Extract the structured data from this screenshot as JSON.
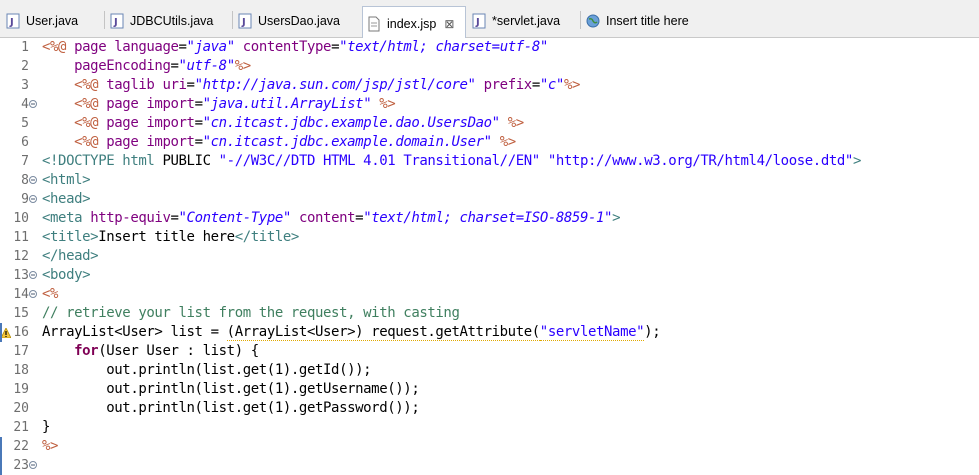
{
  "tabs": [
    {
      "label": "User.java",
      "icon": "java-file-icon",
      "active": false
    },
    {
      "label": "JDBCUtils.java",
      "icon": "java-file-icon",
      "active": false
    },
    {
      "label": "UsersDao.java",
      "icon": "java-file-icon",
      "active": false
    },
    {
      "label": "index.jsp",
      "icon": "jsp-file-icon",
      "active": true,
      "close": "⊠"
    },
    {
      "label": "*servlet.java",
      "icon": "java-file-icon",
      "active": false
    },
    {
      "label": "Insert title here",
      "icon": "globe-icon",
      "active": false
    }
  ],
  "lines": [
    {
      "n": "1",
      "fold": false,
      "warn": false,
      "segs": [
        [
          "jsp",
          "<%@ "
        ],
        [
          "attr",
          "page "
        ],
        [
          "attr",
          "language"
        ],
        [
          "plain",
          "="
        ],
        [
          "str",
          "\"java\""
        ],
        [
          "plain",
          " "
        ],
        [
          "attr",
          "contentType"
        ],
        [
          "plain",
          "="
        ],
        [
          "str",
          "\"text/html; charset=utf-8\""
        ]
      ]
    },
    {
      "n": "2",
      "fold": false,
      "warn": false,
      "segs": [
        [
          "plain",
          "    "
        ],
        [
          "attr",
          "pageEncoding"
        ],
        [
          "plain",
          "="
        ],
        [
          "str",
          "\"utf-8\""
        ],
        [
          "jsp",
          "%>"
        ]
      ]
    },
    {
      "n": "3",
      "fold": false,
      "warn": false,
      "segs": [
        [
          "plain",
          "    "
        ],
        [
          "jsp",
          "<%@ "
        ],
        [
          "attr",
          "taglib "
        ],
        [
          "attr",
          "uri"
        ],
        [
          "plain",
          "="
        ],
        [
          "str",
          "\"http://java.sun.com/jsp/jstl/core\""
        ],
        [
          "plain",
          " "
        ],
        [
          "attr",
          "prefix"
        ],
        [
          "plain",
          "="
        ],
        [
          "str",
          "\"c\""
        ],
        [
          "jsp",
          "%>"
        ]
      ]
    },
    {
      "n": "4",
      "fold": true,
      "warn": false,
      "segs": [
        [
          "plain",
          "    "
        ],
        [
          "jsp",
          "<%@ "
        ],
        [
          "attr",
          "page "
        ],
        [
          "attr",
          "import"
        ],
        [
          "plain",
          "="
        ],
        [
          "str",
          "\"java.util.ArrayList\""
        ],
        [
          "plain",
          " "
        ],
        [
          "jsp",
          "%>"
        ]
      ]
    },
    {
      "n": "5",
      "fold": false,
      "warn": false,
      "segs": [
        [
          "plain",
          "    "
        ],
        [
          "jsp",
          "<%@ "
        ],
        [
          "attr",
          "page "
        ],
        [
          "attr",
          "import"
        ],
        [
          "plain",
          "="
        ],
        [
          "str",
          "\"cn.itcast.jdbc.example.dao.UsersDao\""
        ],
        [
          "plain",
          " "
        ],
        [
          "jsp",
          "%>"
        ]
      ]
    },
    {
      "n": "6",
      "fold": false,
      "warn": false,
      "segs": [
        [
          "plain",
          "    "
        ],
        [
          "jsp",
          "<%@ "
        ],
        [
          "attr",
          "page "
        ],
        [
          "attr",
          "import"
        ],
        [
          "plain",
          "="
        ],
        [
          "str",
          "\"cn.itcast.jdbc.example.domain.User\""
        ],
        [
          "plain",
          " "
        ],
        [
          "jsp",
          "%>"
        ]
      ]
    },
    {
      "n": "7",
      "fold": false,
      "warn": false,
      "segs": [
        [
          "tag",
          "<!DOCTYPE "
        ],
        [
          "tag",
          "html "
        ],
        [
          "plain",
          "PUBLIC "
        ],
        [
          "javastr",
          "\"-//W3C//DTD HTML 4.01 Transitional//EN\""
        ],
        [
          "plain",
          " "
        ],
        [
          "javastr",
          "\"http://www.w3.org/TR/html4/loose.dtd\""
        ],
        [
          "tag",
          ">"
        ]
      ]
    },
    {
      "n": "8",
      "fold": true,
      "warn": false,
      "segs": [
        [
          "tag",
          "<html>"
        ]
      ]
    },
    {
      "n": "9",
      "fold": true,
      "warn": false,
      "segs": [
        [
          "tag",
          "<head>"
        ]
      ]
    },
    {
      "n": "10",
      "fold": false,
      "warn": false,
      "segs": [
        [
          "tag",
          "<meta "
        ],
        [
          "attr",
          "http-equiv"
        ],
        [
          "plain",
          "="
        ],
        [
          "str",
          "\"Content-Type\""
        ],
        [
          "plain",
          " "
        ],
        [
          "attr",
          "content"
        ],
        [
          "plain",
          "="
        ],
        [
          "str",
          "\"text/html; charset=ISO-8859-1\""
        ],
        [
          "tag",
          ">"
        ]
      ]
    },
    {
      "n": "11",
      "fold": false,
      "warn": false,
      "segs": [
        [
          "tag",
          "<title>"
        ],
        [
          "plain",
          "Insert title here"
        ],
        [
          "tag",
          "</title>"
        ]
      ]
    },
    {
      "n": "12",
      "fold": false,
      "warn": false,
      "segs": [
        [
          "tag",
          "</head>"
        ]
      ]
    },
    {
      "n": "13",
      "fold": true,
      "warn": false,
      "segs": [
        [
          "tag",
          "<body>"
        ]
      ]
    },
    {
      "n": "14",
      "fold": true,
      "warn": false,
      "segs": [
        [
          "jsp",
          "<%"
        ]
      ]
    },
    {
      "n": "15",
      "fold": false,
      "warn": false,
      "segs": [
        [
          "comment",
          "// retrieve your list from the request, with casting"
        ]
      ]
    },
    {
      "n": "16",
      "fold": false,
      "warn": true,
      "segs": [
        [
          "plain",
          "ArrayList<User> list = "
        ],
        [
          "warnplain",
          "(ArrayList<User>) request.getAttribute("
        ],
        [
          "warnstr",
          "\"servletName\""
        ],
        [
          "plain",
          ");"
        ]
      ]
    },
    {
      "n": "17",
      "fold": false,
      "warn": false,
      "segs": [
        [
          "plain",
          "    "
        ],
        [
          "kw",
          "for"
        ],
        [
          "plain",
          "(User User : list) {"
        ]
      ]
    },
    {
      "n": "18",
      "fold": false,
      "warn": false,
      "segs": [
        [
          "plain",
          "        out.println(list.get(1).getId());"
        ]
      ]
    },
    {
      "n": "19",
      "fold": false,
      "warn": false,
      "segs": [
        [
          "plain",
          "        out.println(list.get(1).getUsername());"
        ]
      ]
    },
    {
      "n": "20",
      "fold": false,
      "warn": false,
      "segs": [
        [
          "plain",
          "        out.println(list.get(1).getPassword());"
        ]
      ]
    },
    {
      "n": "21",
      "fold": false,
      "warn": false,
      "segs": [
        [
          "plain",
          "}"
        ]
      ]
    },
    {
      "n": "22",
      "fold": false,
      "warn": false,
      "segs": [
        [
          "jsp",
          "%>"
        ]
      ]
    },
    {
      "n": "23",
      "fold": true,
      "warn": false,
      "segs": []
    }
  ]
}
